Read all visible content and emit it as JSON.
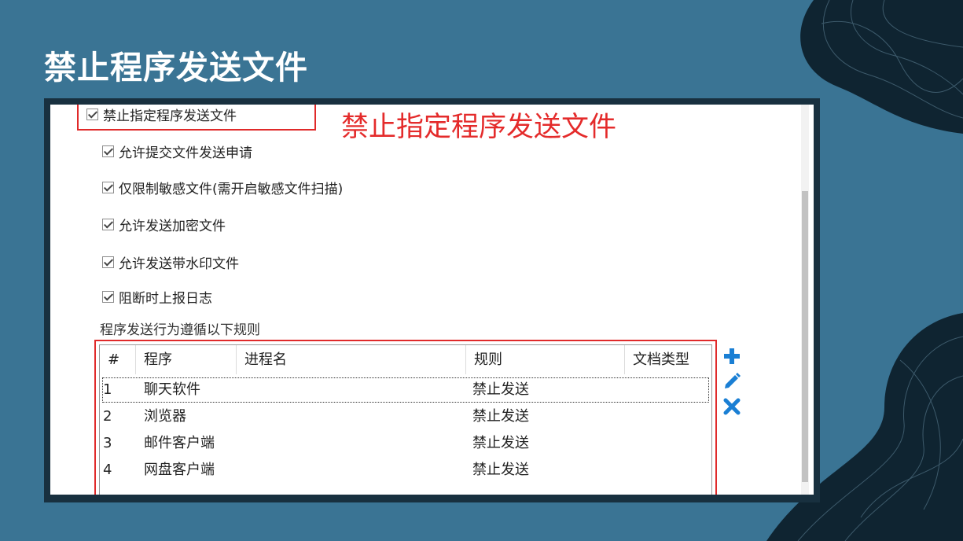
{
  "slide": {
    "title": "禁止程序发送文件"
  },
  "panel": {
    "main_checkbox": {
      "label": "禁止指定程序发送文件",
      "checked": true
    },
    "annotation": "禁止指定程序发送文件",
    "options": [
      {
        "label": "允许提交文件发送申请",
        "checked": true
      },
      {
        "label": "仅限制敏感文件(需开启敏感文件扫描)",
        "checked": true
      },
      {
        "label": "允许发送加密文件",
        "checked": true
      },
      {
        "label": "允许发送带水印文件",
        "checked": true
      },
      {
        "label": "阻断时上报日志",
        "checked": true
      }
    ],
    "rules_label": "程序发送行为遵循以下规则",
    "table": {
      "columns": [
        "#",
        "程序",
        "进程名",
        "规则",
        "文档类型"
      ],
      "rows": [
        {
          "num": "1",
          "program": "聊天软件",
          "process": "",
          "rule": "禁止发送",
          "doc_type": ""
        },
        {
          "num": "2",
          "program": "浏览器",
          "process": "",
          "rule": "禁止发送",
          "doc_type": ""
        },
        {
          "num": "3",
          "program": "邮件客户端",
          "process": "",
          "rule": "禁止发送",
          "doc_type": ""
        },
        {
          "num": "4",
          "program": "网盘客户端",
          "process": "",
          "rule": "禁止发送",
          "doc_type": ""
        }
      ]
    },
    "actions": [
      "add-icon",
      "edit-icon",
      "delete-icon"
    ]
  },
  "colors": {
    "background": "#3a7494",
    "highlight": "#e02a2a",
    "action_icon": "#1a7fd4",
    "frame": "#18303f"
  }
}
